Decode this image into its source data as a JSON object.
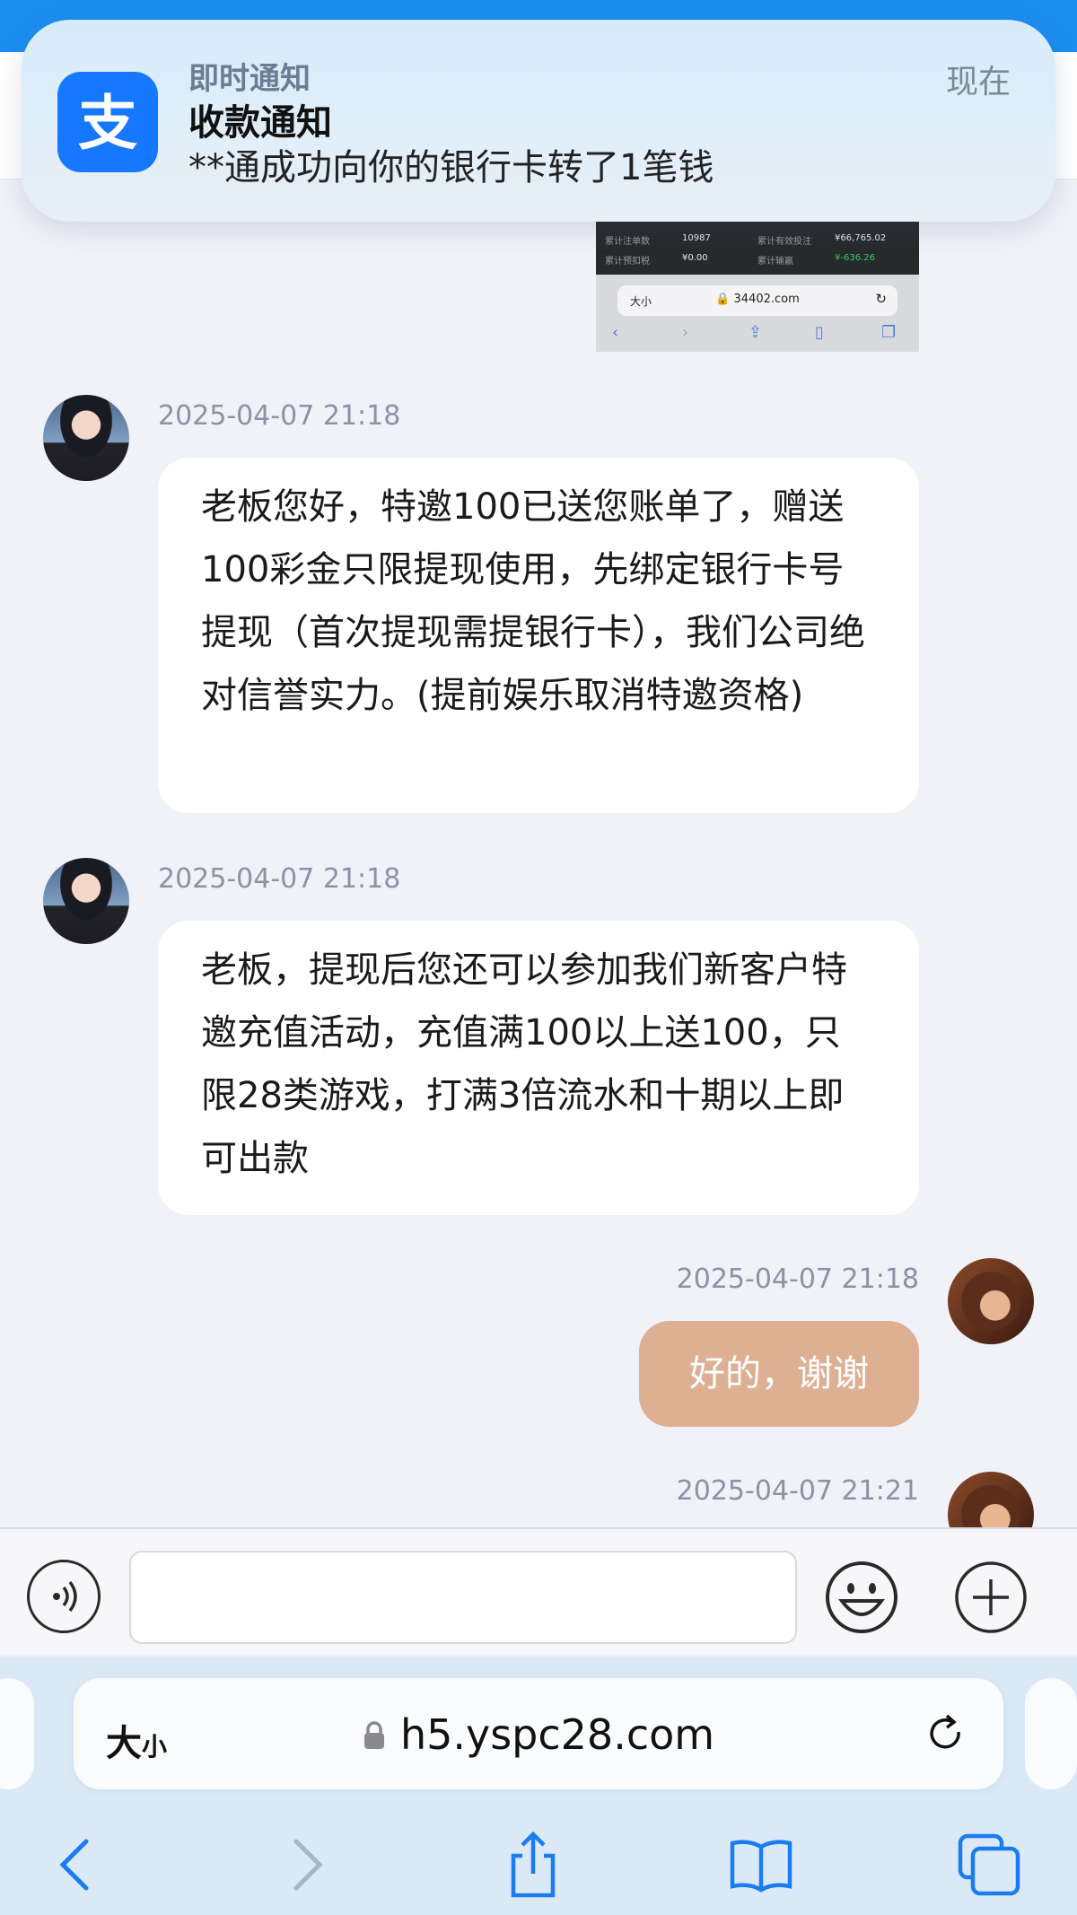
{
  "notification": {
    "app_name": "即时通知",
    "time": "现在",
    "title": "收款通知",
    "body": "**通成功向你的银行卡转了1笔钱",
    "icon": "alipay-icon"
  },
  "thumbnail": {
    "label1": "累计注单数",
    "value1": "10987",
    "label2": "累计有效投注",
    "value2": "¥66,765.02",
    "label3": "累计预扣税",
    "value3": "¥0.00",
    "label4": "累计输赢",
    "value4": "¥-636.26",
    "size_label": "大小",
    "domain": "34402.com"
  },
  "messages": [
    {
      "sender": "agent",
      "time": "2025-04-07 21:18",
      "text": "老板您好，特邀100已送您账单了，赠送100彩金只限提现使用，先绑定银行卡号提现（首次提现需提银行卡），我们公司绝对信誉实力。(提前娱乐取消特邀资格)"
    },
    {
      "sender": "agent",
      "time": "2025-04-07 21:18",
      "text": "老板，提现后您还可以参加我们新客户特邀充值活动，充值满100以上送100，只限28类游戏，打满3倍流水和十期以上即可出款"
    },
    {
      "sender": "me",
      "time": "2025-04-07 21:18",
      "text": "好的，谢谢"
    },
    {
      "sender": "me",
      "time": "2025-04-07 21:21",
      "text": ""
    }
  ],
  "input": {
    "placeholder": "",
    "voice_icon": "voice-icon",
    "emoji_icon": "emoji-icon",
    "plus_icon": "plus-icon"
  },
  "browser": {
    "size_label_big": "大",
    "size_label_small": "小",
    "domain": "h5.yspc28.com"
  },
  "colors": {
    "accent_blue": "#1677ff",
    "my_bubble": "#ddb094",
    "background": "#f1f1f8"
  }
}
